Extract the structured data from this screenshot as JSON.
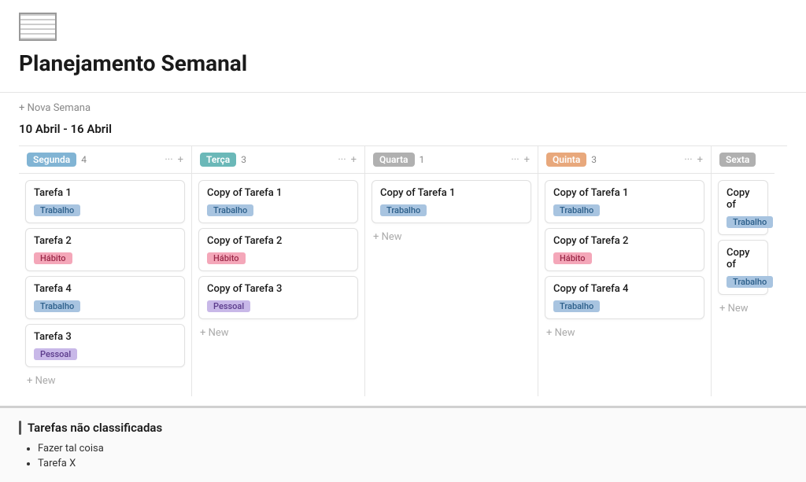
{
  "page": {
    "title": "Planejamento Semanal",
    "add_week_label": "+ Nova Semana",
    "week_range": "10 Abril - 16 Abril"
  },
  "columns": [
    {
      "day": "Segunda",
      "color": "#81b4d4",
      "count": "4",
      "tasks": [
        {
          "name": "Tarefa 1",
          "tag": "Trabalho",
          "tag_type": "trabalho"
        },
        {
          "name": "Tarefa 2",
          "tag": "Hábito",
          "tag_type": "habito"
        },
        {
          "name": "Tarefa 4",
          "tag": "Trabalho",
          "tag_type": "trabalho"
        },
        {
          "name": "Tarefa 3",
          "tag": "Pessoal",
          "tag_type": "pessoal"
        }
      ],
      "show_add": true
    },
    {
      "day": "Terça",
      "color": "#6bb8b8",
      "count": "3",
      "tasks": [
        {
          "name": "Copy of Tarefa 1",
          "tag": "Trabalho",
          "tag_type": "trabalho"
        },
        {
          "name": "Copy of Tarefa 2",
          "tag": "Hábito",
          "tag_type": "habito"
        },
        {
          "name": "Copy of Tarefa 3",
          "tag": "Pessoal",
          "tag_type": "pessoal"
        }
      ],
      "show_add": true
    },
    {
      "day": "Quarta",
      "color": "#b0b0b0",
      "count": "1",
      "tasks": [
        {
          "name": "Copy of Tarefa 1",
          "tag": "Trabalho",
          "tag_type": "trabalho"
        }
      ],
      "show_add": true
    },
    {
      "day": "Quinta",
      "color": "#e8a87c",
      "count": "3",
      "tasks": [
        {
          "name": "Copy of Tarefa 1",
          "tag": "Trabalho",
          "tag_type": "trabalho"
        },
        {
          "name": "Copy of Tarefa 2",
          "tag": "Hábito",
          "tag_type": "habito"
        },
        {
          "name": "Copy of Tarefa 4",
          "tag": "Trabalho",
          "tag_type": "trabalho"
        }
      ],
      "show_add": true
    },
    {
      "day": "Sexta",
      "color": "#b0b0b0",
      "count": "",
      "tasks": [
        {
          "name": "Copy of",
          "tag": "Trabalho",
          "tag_type": "trabalho"
        },
        {
          "name": "Copy of",
          "tag": "Trabalho",
          "tag_type": "trabalho"
        }
      ],
      "show_add": true,
      "partial": true
    }
  ],
  "unclassified": {
    "header": "Tarefas não classificadas",
    "items": [
      "Fazer tal coisa",
      "Tarefa X"
    ]
  },
  "copy_label": "Copy"
}
